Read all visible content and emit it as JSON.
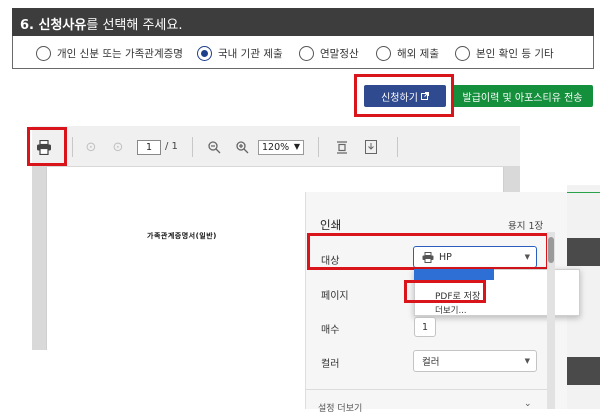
{
  "section": {
    "number": "6.",
    "title_bold": "신청사유",
    "title_rest": "를 선택해 주세요."
  },
  "reasons": {
    "options": [
      {
        "label": "개인 신분 또는 가족관계증명",
        "selected": false
      },
      {
        "label": "국내 기관 제출",
        "selected": true
      },
      {
        "label": "연말정산",
        "selected": false
      },
      {
        "label": "해외 제출",
        "selected": false
      },
      {
        "label": "본인 확인 등 기타",
        "selected": false
      }
    ]
  },
  "buttons": {
    "apply_label": "신청하기",
    "apply_icon": "external-link-icon",
    "send_label": "발급이력 및 아포스티유 전송"
  },
  "viewer": {
    "page_current": "1",
    "page_total": "/ 1",
    "zoom": "120%"
  },
  "preview": {
    "doc_title": "가족관계증명서(일반)"
  },
  "print_dialog": {
    "title": "인쇄",
    "sheets": "용지 1장",
    "destination_label": "대상",
    "destination_value": "HP",
    "dropdown_option_pdf": "PDF로 저장",
    "dropdown_option_more": "더보기...",
    "pages_label": "페이지",
    "copies_label": "매수",
    "copies_value": "1",
    "color_label": "컬러",
    "color_value": "컬러",
    "more_settings": "설정 더보기"
  },
  "colors": {
    "header_bg": "#3d3d3d",
    "apply_btn": "#2f4a8e",
    "send_btn": "#148f3c",
    "highlight_red": "#d9141b",
    "focus_blue": "#2b5fbf"
  }
}
